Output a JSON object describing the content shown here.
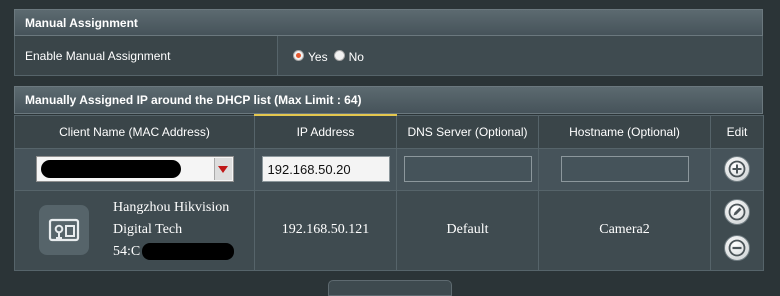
{
  "manual": {
    "title": "Manual Assignment",
    "enable_label": "Enable Manual Assignment",
    "options": [
      {
        "label": "Yes",
        "checked": true
      },
      {
        "label": "No",
        "checked": false
      }
    ]
  },
  "list": {
    "title": "Manually Assigned IP around the DHCP list (Max Limit : 64)",
    "columns": [
      "Client Name (MAC Address)",
      "IP Address",
      "DNS Server (Optional)",
      "Hostname (Optional)",
      "Edit"
    ],
    "input_row": {
      "ip_value": "192.168.50.20",
      "dns_value": "",
      "hostname_value": ""
    },
    "entries": [
      {
        "name_line1": "Hangzhou Hikvision",
        "name_line2": "Digital Tech",
        "mac_prefix": "54:C",
        "ip": "192.168.50.121",
        "dns": "Default",
        "hostname": "Camera2"
      }
    ]
  },
  "colors": {
    "accent": "#e4572e",
    "active_tab": "#e4c74e",
    "background": "#2b3437"
  },
  "icons": [
    "add-icon",
    "edit-icon",
    "remove-icon",
    "device-icon",
    "dropdown-arrow-icon"
  ]
}
